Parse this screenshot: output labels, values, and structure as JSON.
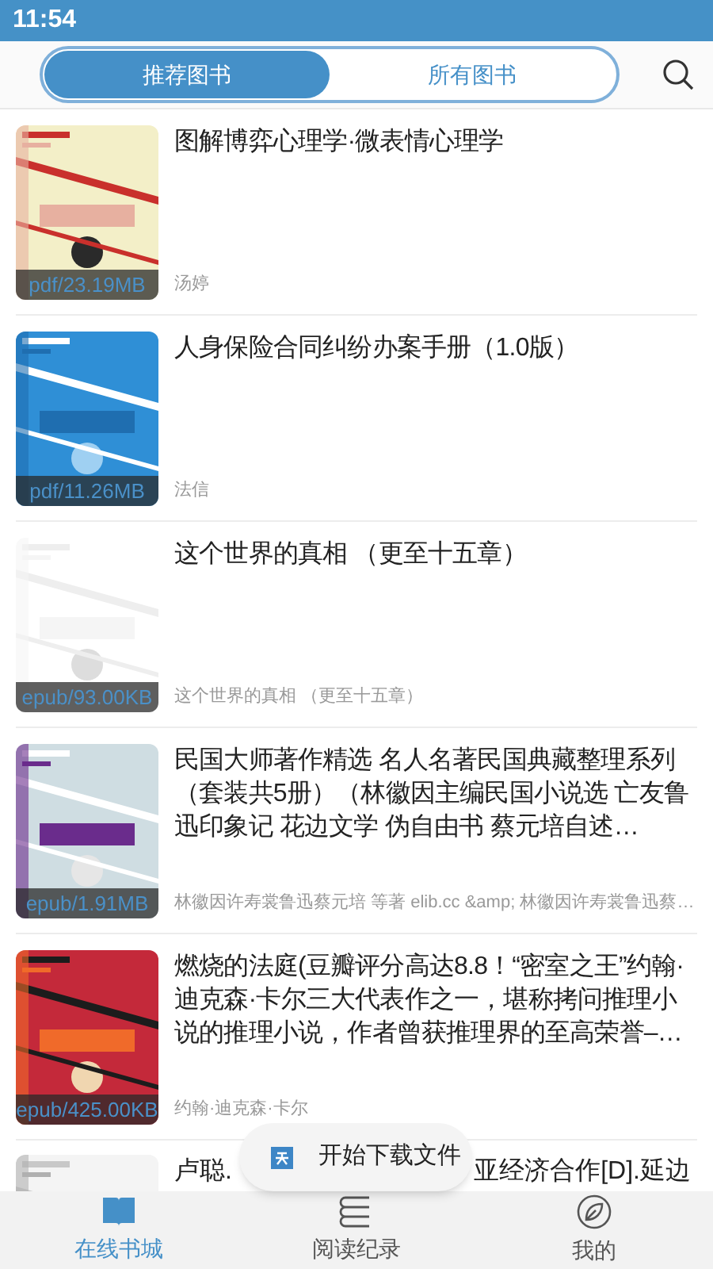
{
  "status_bar": {
    "time": "11:54"
  },
  "tabs": [
    {
      "label": "推荐图书",
      "selected": true
    },
    {
      "label": "所有图书",
      "selected": false
    }
  ],
  "books": [
    {
      "cover": {
        "kind": "picture"
      },
      "badge": "pdf/23.19MB",
      "title": "图解博弈心理学·微表情心理学",
      "author": "汤婷"
    },
    {
      "cover": {
        "kind": "picture"
      },
      "badge": "pdf/11.26MB",
      "title": "人身保险合同纠纷办案手册（1.0版）",
      "author": "法信"
    },
    {
      "cover": {
        "kind": "picture"
      },
      "badge": "epub/93.00KB",
      "title": "这个世界的真相 （更至十五章）",
      "author": "这个世界的真相 （更至十五章）"
    },
    {
      "cover": {
        "kind": "picture"
      },
      "badge": "epub/1.91MB",
      "title": "民国大师著作精选 名人名著民国典藏整理系列（套装共5册）（林徽因主编民国小说选 亡友鲁迅印象记 花边文学 伪自由书 蔡元培自述…",
      "author": "林徽因许寿裳鲁迅蔡元培 等著 elib.cc &amp; 林徽因许寿裳鲁迅蔡…"
    },
    {
      "cover": {
        "kind": "picture"
      },
      "badge": "epub/425.00KB",
      "title": "燃烧的法庭(豆瓣评分高达8.8！“密室之王”约翰·迪克森·卡尔三大代表作之一，堪称拷问推理小说的推理小说，作者曾获推理界的至高荣誉–…",
      "author": "约翰·迪克森·卡尔"
    }
  ],
  "partial_book": {
    "cover": {
      "kind": "picture"
    },
    "title_parts": [
      "卢聪.",
      "亚经济合作[D].延边"
    ]
  },
  "toast": {
    "text": "开始下载文件"
  },
  "bottom_nav": [
    {
      "label": "在线书城",
      "selected": true
    },
    {
      "label": "阅读纪录",
      "selected": false
    },
    {
      "label": "我的",
      "selected": false
    }
  ]
}
